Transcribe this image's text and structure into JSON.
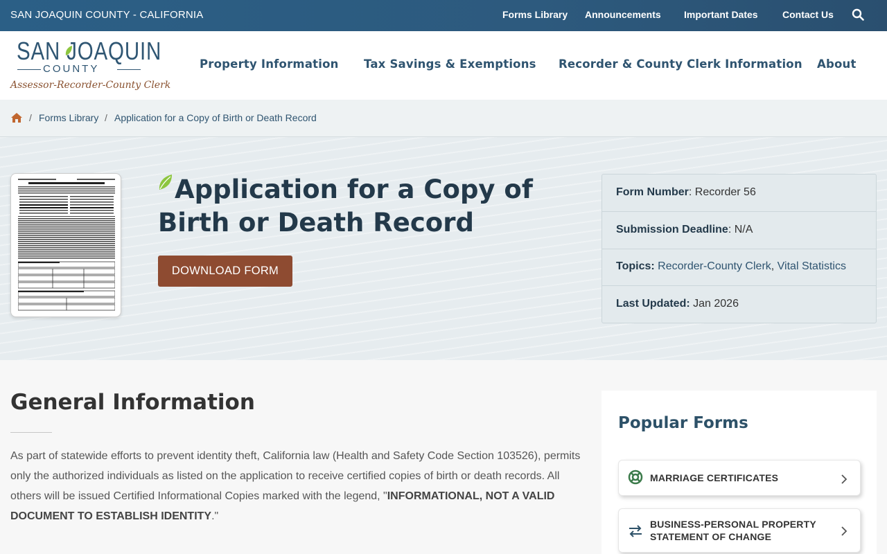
{
  "topbar": {
    "county_label": "SAN JOAQUIN COUNTY - CALIFORNIA",
    "links": [
      "Forms Library",
      "Announcements",
      "Important Dates",
      "Contact Us"
    ]
  },
  "logo": {
    "line1": "SAN JOAQUIN",
    "line2": "COUNTY",
    "tagline": "Assessor-Recorder-County Clerk"
  },
  "main_nav": [
    "Property Information",
    "Tax Savings & Exemptions",
    "Recorder & County Clerk Information",
    "About"
  ],
  "breadcrumb": {
    "items": [
      "Forms Library",
      "Application for a Copy of Birth or Death Record"
    ],
    "separator": "/"
  },
  "hero": {
    "title": "Application for a Copy of Birth or Death Record",
    "download_label": "DOWNLOAD FORM"
  },
  "meta": {
    "form_number_label": "Form Number",
    "form_number": "Recorder 56",
    "deadline_label": "Submission Deadline",
    "deadline": "N/A",
    "topics_label": "Topics:",
    "topics": [
      "Recorder-County Clerk",
      "Vital Statistics"
    ],
    "updated_label": "Last Updated:",
    "updated": "Jan 2026"
  },
  "general": {
    "title": "General Information",
    "text_before": "As part of statewide efforts to prevent identity theft, California law (Health and Safety Code Section 103526), permits only the authorized individuals as listed on the application to receive certified copies of birth or death records. All others will be issued Certified Informational Copies marked with the legend, \"",
    "text_bold": "INFORMATIONAL, NOT A VALID DOCUMENT TO ESTABLISH IDENTITY",
    "text_after": ".\""
  },
  "popular": {
    "title": "Popular Forms",
    "items": [
      {
        "label": "MARRIAGE CERTIFICATES",
        "icon": "rings-icon"
      },
      {
        "label": "BUSINESS-PERSONAL PROPERTY STATEMENT OF CHANGE",
        "icon": "swap-arrows-icon"
      }
    ]
  },
  "colors": {
    "topbar": "#2b5f86",
    "nav_text": "#2f5470",
    "download_button": "#8e4b31",
    "leaf_green": "#8dc63f"
  }
}
